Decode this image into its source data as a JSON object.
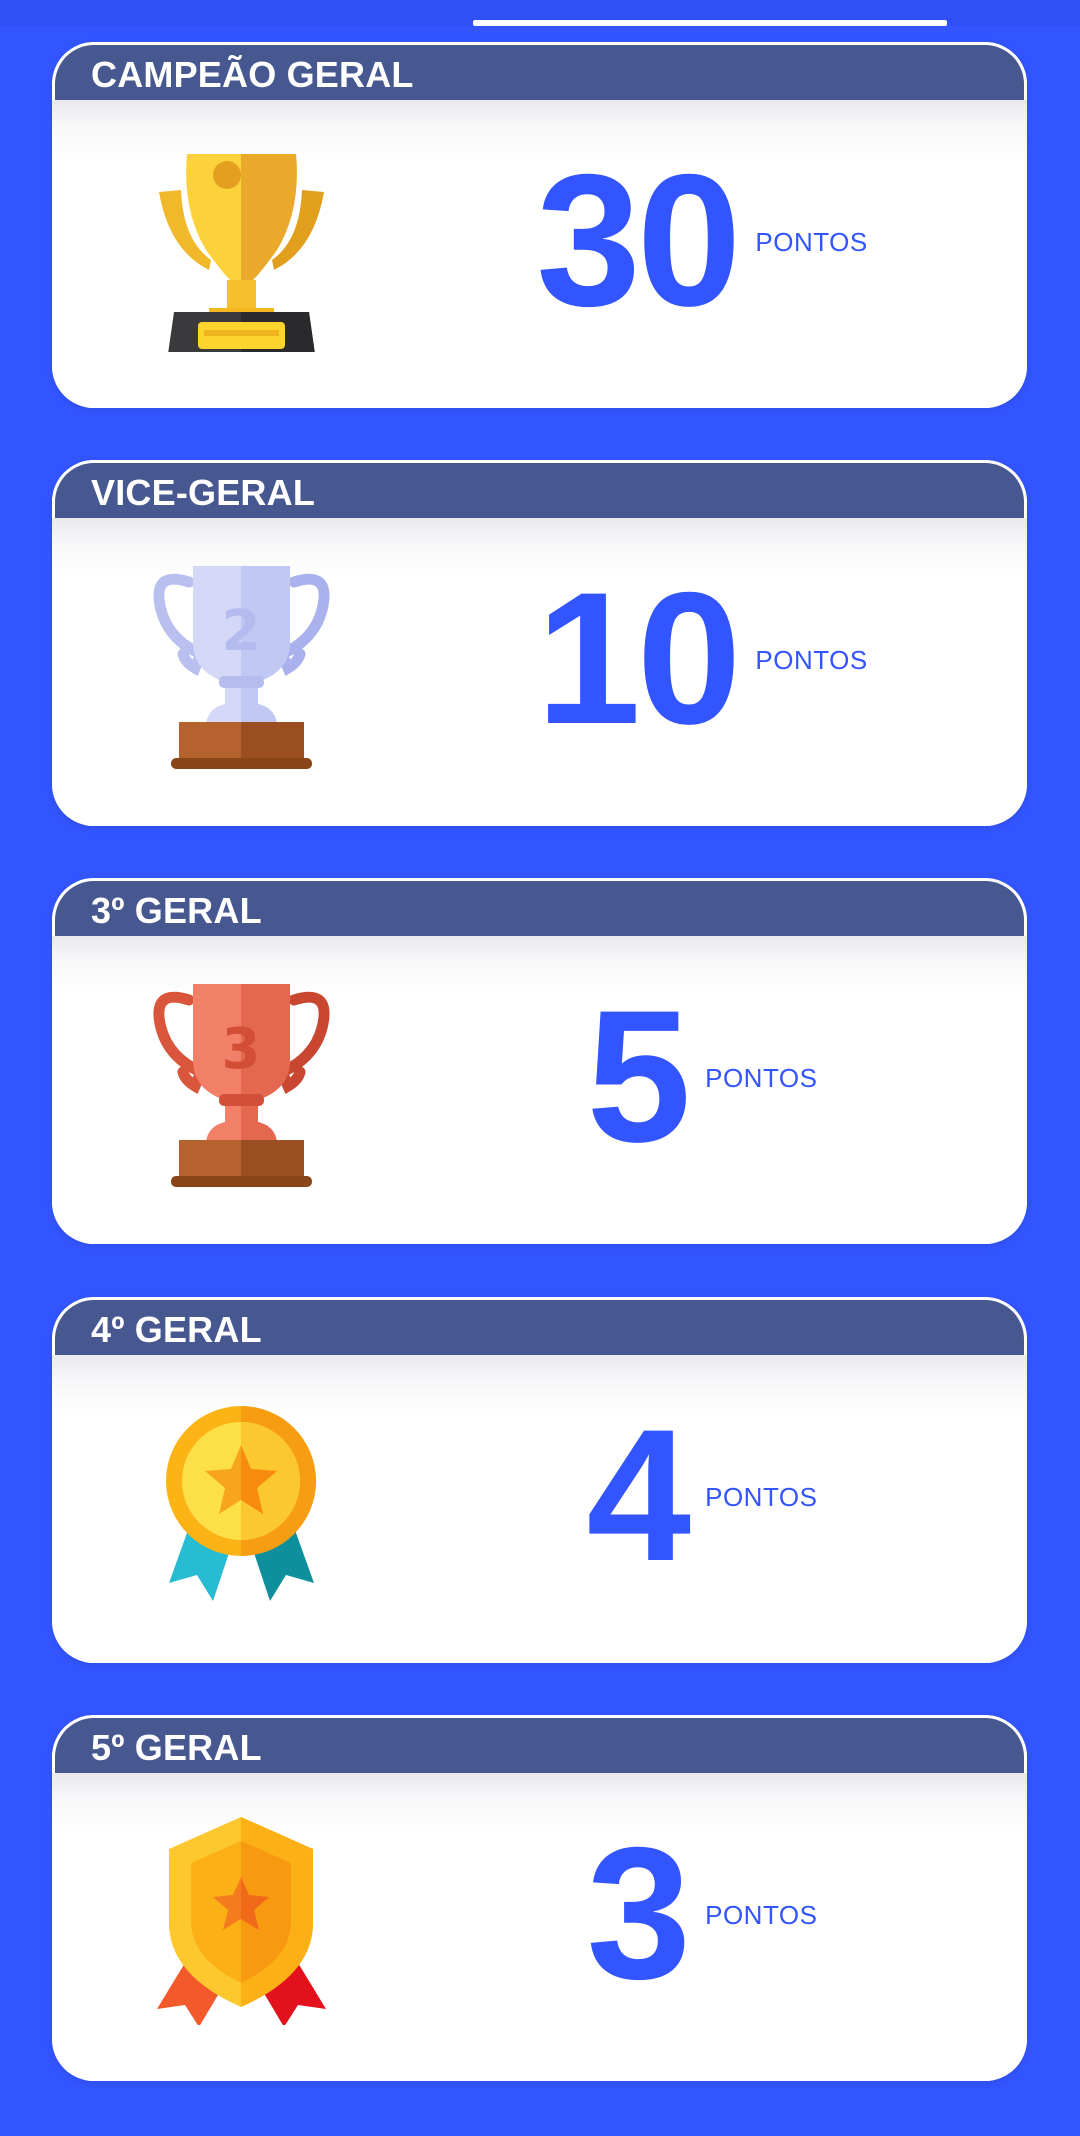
{
  "unit_label": "PONTOS",
  "cards": [
    {
      "title": "CAMPEÃO GERAL",
      "points": "30",
      "icon": "gold-trophy-icon"
    },
    {
      "title": "VICE-GERAL",
      "points": "10",
      "icon": "silver-trophy-2-icon"
    },
    {
      "title": "3º GERAL",
      "points": "5",
      "icon": "bronze-trophy-3-icon"
    },
    {
      "title": "4º GERAL",
      "points": "4",
      "icon": "star-medal-icon"
    },
    {
      "title": "5º GERAL",
      "points": "3",
      "icon": "shield-badge-icon"
    }
  ],
  "colors": {
    "background": "#3355FF",
    "header": "#46588F",
    "accent": "#3355FF"
  }
}
